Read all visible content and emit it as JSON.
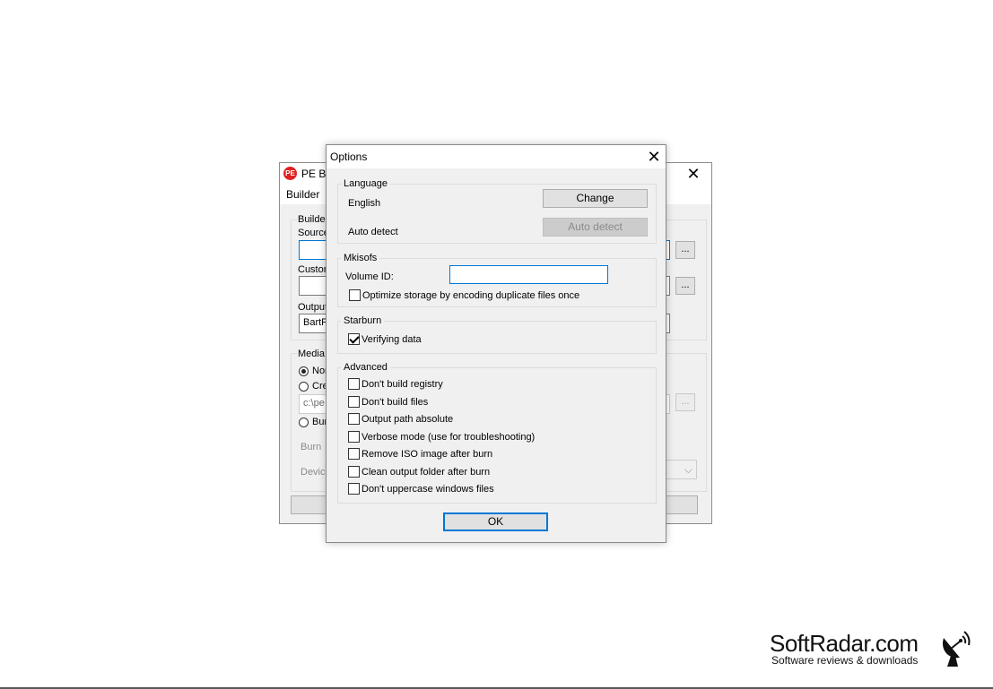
{
  "main_window": {
    "icon_text": "PE",
    "title": "PE Bu",
    "menu": [
      "Builder"
    ],
    "builder_group_label": "Builder",
    "source_label": "Source",
    "custom_label": "Custom",
    "output_label": "Output",
    "output_value": "BartP",
    "browse_label": "...",
    "media_label": "Media",
    "radio_none": "Non",
    "radio_create": "Cre",
    "iso_path": "c:\\pe",
    "radio_burn": "Bur",
    "burn_label": "Burn",
    "device_label": "Device"
  },
  "dialog": {
    "title": "Options",
    "language": {
      "group_title": "Language",
      "current": "English",
      "auto_detect_label": "Auto detect",
      "change_button": "Change",
      "auto_detect_button": "Auto detect"
    },
    "mkisofs": {
      "group_title": "Mkisofs",
      "volume_id_label": "Volume ID:",
      "volume_id_value": "",
      "optimize_label": "Optimize storage by encoding duplicate files once",
      "optimize_checked": false
    },
    "starburn": {
      "group_title": "Starburn",
      "verify_label": "Verifying data",
      "verify_checked": true
    },
    "advanced": {
      "group_title": "Advanced",
      "options": [
        {
          "label": "Don't build registry",
          "checked": false
        },
        {
          "label": "Don't build files",
          "checked": false
        },
        {
          "label": "Output path absolute",
          "checked": false
        },
        {
          "label": "Verbose mode (use for troubleshooting)",
          "checked": false
        },
        {
          "label": "Remove ISO image after burn",
          "checked": false
        },
        {
          "label": "Clean output folder after burn",
          "checked": false
        },
        {
          "label": "Don't uppercase windows files",
          "checked": false
        }
      ]
    },
    "ok_button": "OK"
  },
  "watermark": {
    "name": "SoftRadar.com",
    "tagline": "Software reviews & downloads"
  },
  "colors": {
    "accent": "#0078d7",
    "dialog_bg": "#f0f0f0",
    "icon_red": "#e02020"
  }
}
